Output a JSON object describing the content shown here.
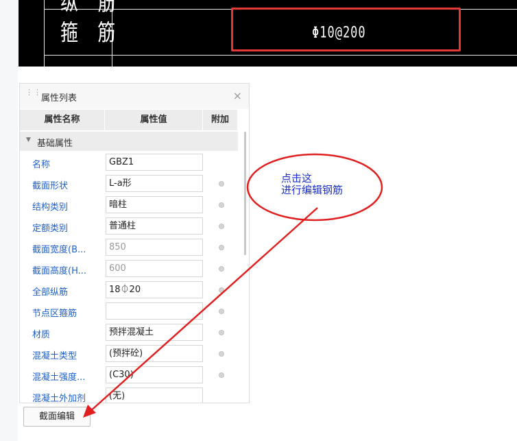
{
  "cad": {
    "row_label_top": "纵 筋",
    "row_label": "箍 筋",
    "stirrup_value": "Φ10@200",
    "highlight_color": "#e53935"
  },
  "panel": {
    "title": "属性列表",
    "close_glyph": "×",
    "columns": [
      "属性名称",
      "属性值",
      "附加"
    ],
    "group_label": "基础属性",
    "rows": [
      {
        "name": "名称",
        "value": "GBZ1",
        "muted": false,
        "has_dot": false
      },
      {
        "name": "截面形状",
        "value": "L-a形",
        "muted": false,
        "has_dot": true
      },
      {
        "name": "结构类别",
        "value": "暗柱",
        "muted": false,
        "has_dot": true
      },
      {
        "name": "定额类别",
        "value": "普通柱",
        "muted": false,
        "has_dot": true
      },
      {
        "name": "截面宽度(B...",
        "value": "850",
        "muted": true,
        "has_dot": true
      },
      {
        "name": "截面高度(H...",
        "value": "600",
        "muted": true,
        "has_dot": true
      },
      {
        "name": "全部纵筋",
        "value": "18⏀20",
        "muted": false,
        "has_dot": true
      },
      {
        "name": "节点区箍筋",
        "value": "",
        "muted": false,
        "has_dot": true
      },
      {
        "name": "材质",
        "value": "预拌混凝土",
        "muted": false,
        "has_dot": true
      },
      {
        "name": "混凝土类型",
        "value": "(预拌砼)",
        "muted": false,
        "has_dot": true
      },
      {
        "name": "混凝土强度...",
        "value": "(C30)",
        "muted": false,
        "has_dot": true
      },
      {
        "name": "混凝土外加剂",
        "value": "(无)",
        "muted": false,
        "has_dot": false
      }
    ]
  },
  "section_edit_button": "截面编辑",
  "annotation": {
    "line1": "点击这",
    "line2": "进行编辑钢筋",
    "color": "#e02020"
  }
}
